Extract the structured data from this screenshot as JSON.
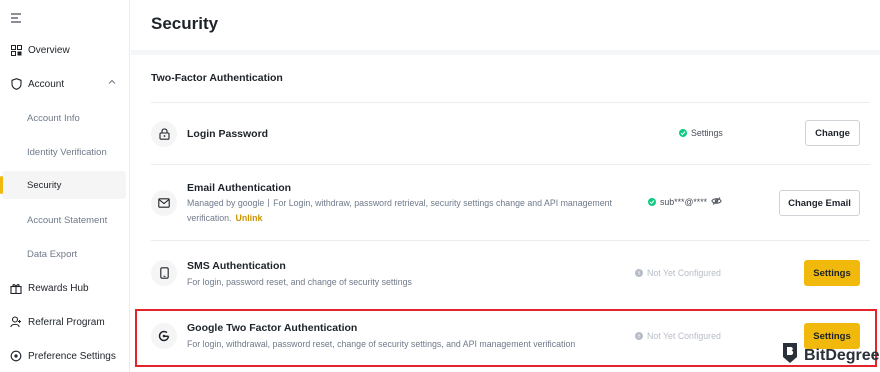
{
  "sidebar": {
    "items": [
      {
        "label": "Overview",
        "icon": "grid-icon"
      },
      {
        "label": "Account",
        "icon": "shield-icon"
      },
      {
        "label": "Rewards Hub",
        "icon": "gift-icon"
      },
      {
        "label": "Referral Program",
        "icon": "user-plus-icon"
      },
      {
        "label": "Preference Settings",
        "icon": "settings-icon"
      }
    ],
    "account_subitems": [
      {
        "label": "Account Info"
      },
      {
        "label": "Identity Verification"
      },
      {
        "label": "Security",
        "active": true
      },
      {
        "label": "Account Statement"
      },
      {
        "label": "Data Export"
      }
    ]
  },
  "page": {
    "title": "Security",
    "section_title": "Two-Factor Authentication"
  },
  "rows": {
    "login_password": {
      "title": "Login Password",
      "status": "Settings",
      "button": "Change"
    },
    "email": {
      "title": "Email Authentication",
      "desc_line1": "Managed by google丨For Login, withdraw, password retrieval, security settings change and API management",
      "desc_line2": "verification.",
      "unlink": "Unlink",
      "status": "sub***@****",
      "button": "Change Email"
    },
    "sms": {
      "title": "SMS Authentication",
      "desc": "For login, password reset, and change of security settings",
      "status": "Not Yet Configured",
      "button": "Settings"
    },
    "google": {
      "title": "Google Two Factor Authentication",
      "desc": "For login, withdrawal, password reset, change of security settings, and API management verification",
      "status": "Not Yet Configured",
      "button": "Settings"
    }
  },
  "watermark": {
    "text": "BitDegree"
  },
  "colors": {
    "accent": "#f0b90b",
    "success": "#0ecb81",
    "highlight": "#e4232b"
  }
}
